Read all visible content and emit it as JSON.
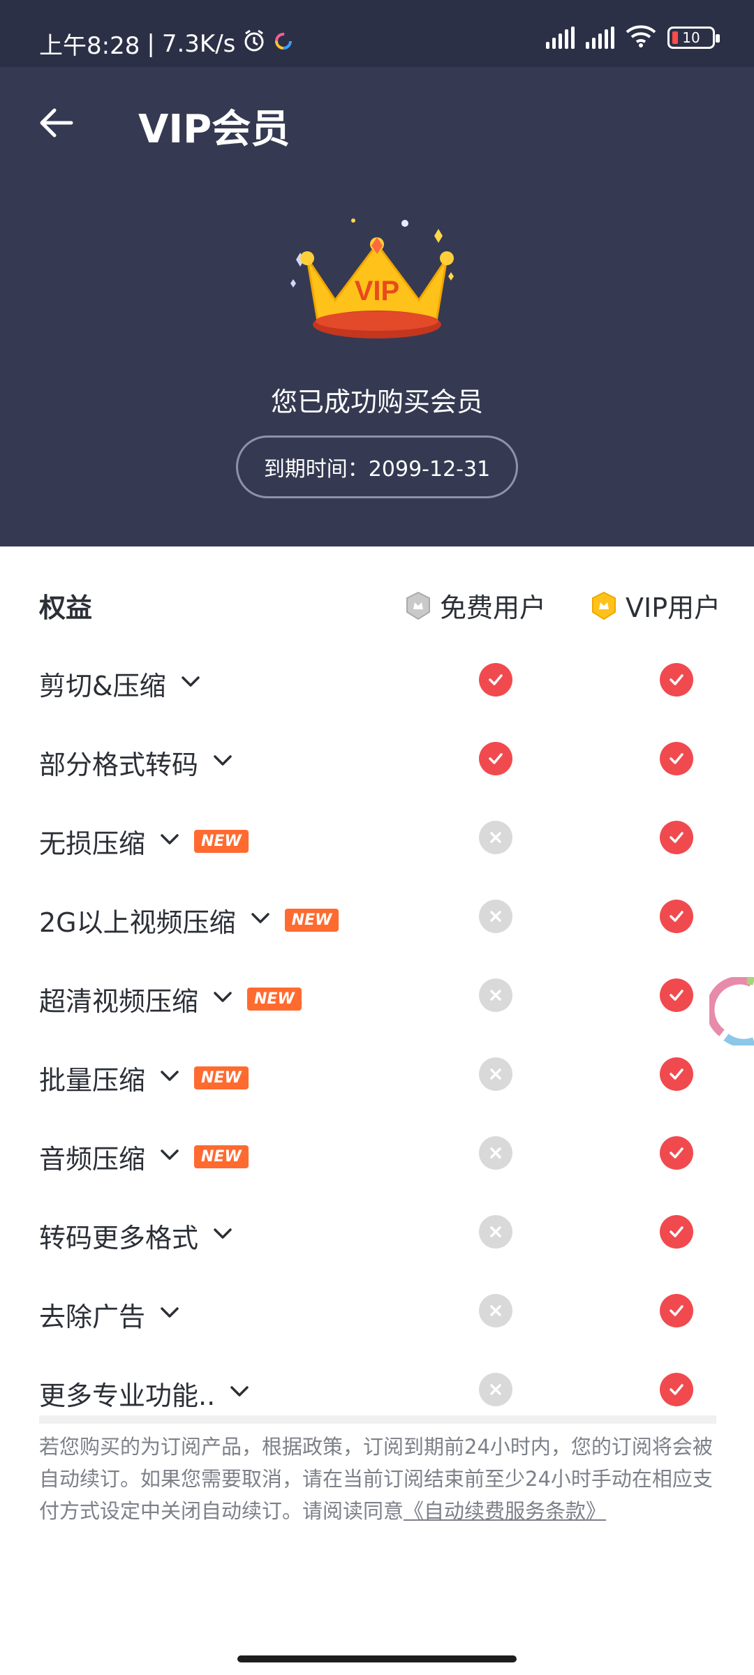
{
  "status_bar": {
    "time": "上午8:28",
    "network_speed": "7.3K/s",
    "battery_level": "10",
    "battery_low_color": "#ff4b4b"
  },
  "header": {
    "title": "VIP会员",
    "purchased_text": "您已成功购买会员",
    "expiry_text": "到期时间：2099-12-31",
    "crown_text": "VIP"
  },
  "table": {
    "col_rights": "权益",
    "col_free": "免费用户",
    "col_vip": "VIP用户",
    "new_badge": "NEW",
    "rows": [
      {
        "label": "剪切&压缩",
        "new": false,
        "free": true,
        "vip": true
      },
      {
        "label": "部分格式转码",
        "new": false,
        "free": true,
        "vip": true
      },
      {
        "label": "无损压缩",
        "new": true,
        "free": false,
        "vip": true
      },
      {
        "label": "2G以上视频压缩",
        "new": true,
        "free": false,
        "vip": true
      },
      {
        "label": "超清视频压缩",
        "new": true,
        "free": false,
        "vip": true
      },
      {
        "label": "批量压缩",
        "new": true,
        "free": false,
        "vip": true
      },
      {
        "label": "音频压缩",
        "new": true,
        "free": false,
        "vip": true
      },
      {
        "label": "转码更多格式",
        "new": false,
        "free": false,
        "vip": true
      },
      {
        "label": "去除广告",
        "new": false,
        "free": false,
        "vip": true
      },
      {
        "label": "更多专业功能..",
        "new": false,
        "free": false,
        "vip": true
      }
    ]
  },
  "notice": {
    "text": "若您购买的为订阅产品，根据政策，订阅到期前24小时内，您的订阅将会被自动续订。如果您需要取消，请在当前订阅结束前至少24小时手动在相应支付方式设定中关闭自动续订。请阅读同意",
    "link": "《自动续费服务条款》"
  },
  "colors": {
    "header_bg": "#353a52",
    "check_red": "#f04a4f",
    "new_orange": "#ff6a2f",
    "disabled_gray": "#d9d9d9"
  }
}
